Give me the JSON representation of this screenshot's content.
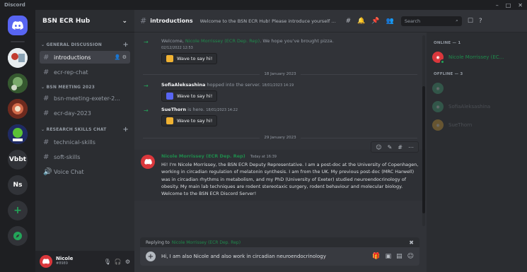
{
  "window": {
    "app_name": "Discord",
    "controls": [
      "–",
      "□",
      "✕"
    ]
  },
  "servers": [
    {
      "label": "",
      "icon": "discord-icon",
      "color": "#5865f2"
    },
    {
      "label": "",
      "icon": "server-avatar",
      "color": "#c9d3da"
    },
    {
      "label": "",
      "icon": "server-avatar",
      "color": "#4b7a44"
    },
    {
      "label": "",
      "icon": "server-avatar",
      "color": "#8e3b2c"
    },
    {
      "label": "",
      "icon": "server-avatar",
      "color": "#3d4b8e"
    },
    {
      "label": "Vbbt"
    },
    {
      "label": "Ns"
    }
  ],
  "guild": {
    "name": "BSN ECR Hub",
    "categories": [
      {
        "name": "GENERAL DISCUSSION",
        "channels": [
          {
            "name": "introductions",
            "active": true
          },
          {
            "name": "ecr-rep-chat"
          }
        ]
      },
      {
        "name": "BSN MEETING 2023",
        "channels": [
          {
            "name": "bsn-meeting-exeter-2..."
          },
          {
            "name": "ecr-day-2023"
          }
        ]
      },
      {
        "name": "RESEARCH SKILLS CHAT",
        "channels": [
          {
            "name": "technical-skills"
          },
          {
            "name": "soft-skills"
          },
          {
            "name": "Voice Chat",
            "voice": true
          }
        ]
      }
    ]
  },
  "user": {
    "name": "Nicole",
    "tag": "#8989"
  },
  "header": {
    "channel": "introductions",
    "topic": "Welcome to the BSN ECR Hub! Please introduce yourself here ...",
    "search_placeholder": "Search"
  },
  "messages": {
    "welcome": {
      "text_pre": "Welcome, ",
      "mention": "Nicole Morrissey (ECR Dep. Rep)",
      "text_post": ". We hope you've brought pizza.",
      "timestamp": "02/12/2022 12:53",
      "wave": "Wave to say hi!"
    },
    "divider_1": "18 January 2023",
    "join_1": {
      "user": "SofiaAleksashina",
      "text": " hopped into the server.",
      "timestamp": "18/01/2023 14:19",
      "wave": "Wave to say hi!"
    },
    "join_2": {
      "user": "SueThorn",
      "text": " is here.",
      "timestamp": "18/01/2023 14:22",
      "wave": "Wave to say hi!"
    },
    "divider_2": "29 January 2023",
    "post": {
      "author": "Nicole Morrissey (ECR Dep. Rep)",
      "timestamp": "Today at 16:39",
      "body": "Hi! I'm Nicole Morrissey, the BSN ECR Deputy Representative. I am a post-doc at the University of Copenhagen, working in circadian regulation of melatonin synthesis. I am from the UK. My previous post-doc (MRC Harwell) was in circadian rhythms in metabolism, and my PhD (University of Exeter) studied neuroendocrinology of obesity. My main lab techniques are rodent stereotaxic surgery, rodent behaviour and molecular biology. Welcome to the BSN ECR Discord Server!"
    }
  },
  "composer": {
    "reply_label": "Replying to",
    "reply_to": "Nicole Morrissey (ECR Dep. Rep)",
    "text_plain": "Hi, I am also Nicole and also work in circadian ",
    "text_misspelled": "neuroendocrinology"
  },
  "members": {
    "online_label": "ONLINE — 1",
    "offline_label": "OFFLINE — 3",
    "online": [
      {
        "name": "Nicole Morrissey (EC...",
        "color": "#da373c"
      }
    ],
    "offline": [
      {
        "name": "",
        "color": "#43b581"
      },
      {
        "name": "SofiaAleksashina",
        "color": "#43b581"
      },
      {
        "name": "SueThorn",
        "color": "#f0b232"
      }
    ]
  },
  "colors": {
    "accent": "#5865f2",
    "mention_green": "#1f8b4c",
    "online_green": "#23a559",
    "danger": "#da373c"
  }
}
